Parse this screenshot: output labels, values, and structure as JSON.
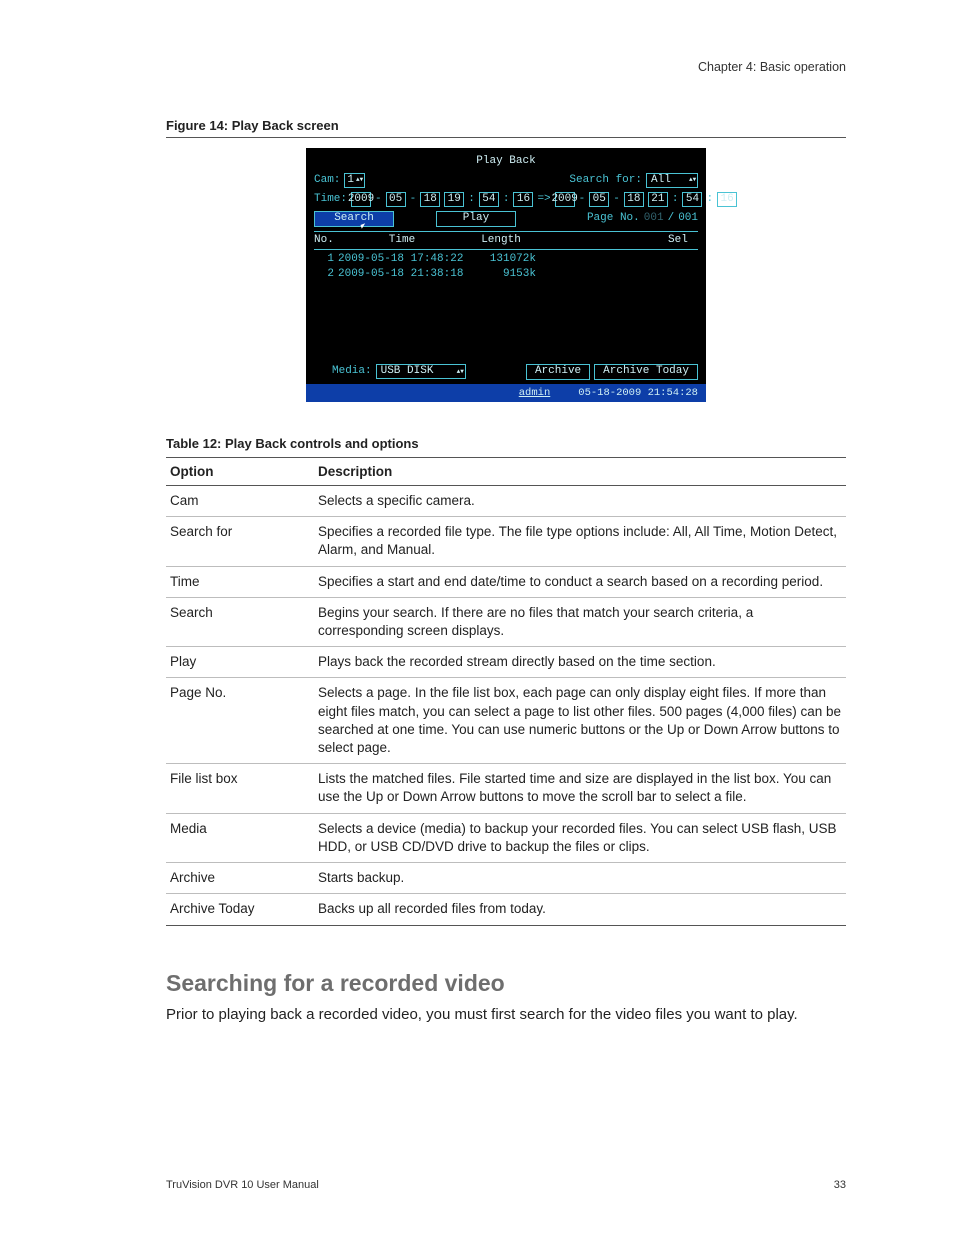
{
  "chapter_header": "Chapter 4: Basic operation",
  "figure_caption": "Figure 14: Play Back screen",
  "dvr": {
    "title": "Play Back",
    "cam_label": "Cam:",
    "cam_value": "1",
    "search_for_label": "Search for:",
    "search_for_value": "All",
    "time_label": "Time:",
    "time_from": {
      "y": "2009",
      "mo": "05",
      "d": "18",
      "h": "19",
      "mi": "54",
      "s": "16"
    },
    "time_arrow": "=>",
    "time_to": {
      "y": "2009",
      "mo": "05",
      "d": "18",
      "h": "21",
      "mi": "54",
      "s": "16"
    },
    "search_btn": "Search",
    "play_btn": "Play",
    "page_label": "Page No.",
    "page_cur": "001",
    "page_sep": "/",
    "page_total": "001",
    "cols": {
      "no": "No.",
      "time": "Time",
      "length": "Length",
      "sel": "Sel"
    },
    "rows": [
      {
        "no": "1",
        "time": "2009-05-18 17:48:22",
        "length": "131072k"
      },
      {
        "no": "2",
        "time": "2009-05-18 21:38:18",
        "length": "9153k"
      }
    ],
    "media_label": "Media:",
    "media_value": "USB DISK",
    "archive_btn": "Archive",
    "archive_today_btn": "Archive Today",
    "status_user": "admin",
    "status_time": "05-18-2009 21:54:28"
  },
  "table_caption": "Table 12: Play Back controls and options",
  "table_head": {
    "option": "Option",
    "desc": "Description"
  },
  "table_rows": [
    {
      "option": "Cam",
      "desc": "Selects a specific camera."
    },
    {
      "option": "Search for",
      "desc": "Specifies a recorded file type. The file type options include: All, All Time, Motion Detect, Alarm, and Manual."
    },
    {
      "option": "Time",
      "desc": "Specifies a start and end date/time to conduct a search based on a recording period."
    },
    {
      "option": "Search",
      "desc": "Begins your search. If there are no files that match your search criteria, a corresponding screen displays."
    },
    {
      "option": "Play",
      "desc": "Plays back the recorded stream directly based on the time section."
    },
    {
      "option": "Page No.",
      "desc": "Selects a page. In the file list box, each page can only display eight files. If more than eight files match, you can select a page to list other files. 500 pages (4,000 files) can be searched at one time. You can use numeric buttons or the Up or Down Arrow buttons to select page."
    },
    {
      "option": "File list box",
      "desc": "Lists the matched files. File started time and size are displayed in the list box. You can use the Up or Down Arrow buttons to move the scroll bar to select a file."
    },
    {
      "option": "Media",
      "desc": "Selects a device (media) to backup your recorded files. You can select USB flash, USB HDD, or USB CD/DVD drive to backup the files or clips."
    },
    {
      "option": "Archive",
      "desc": "Starts backup."
    },
    {
      "option": "Archive Today",
      "desc": "Backs up all recorded files from today."
    }
  ],
  "section_heading": "Searching for a recorded video",
  "section_body": "Prior to playing back a recorded video, you must first search for the video files you want to play.",
  "footer_left": "TruVision DVR 10 User Manual",
  "footer_right": "33"
}
